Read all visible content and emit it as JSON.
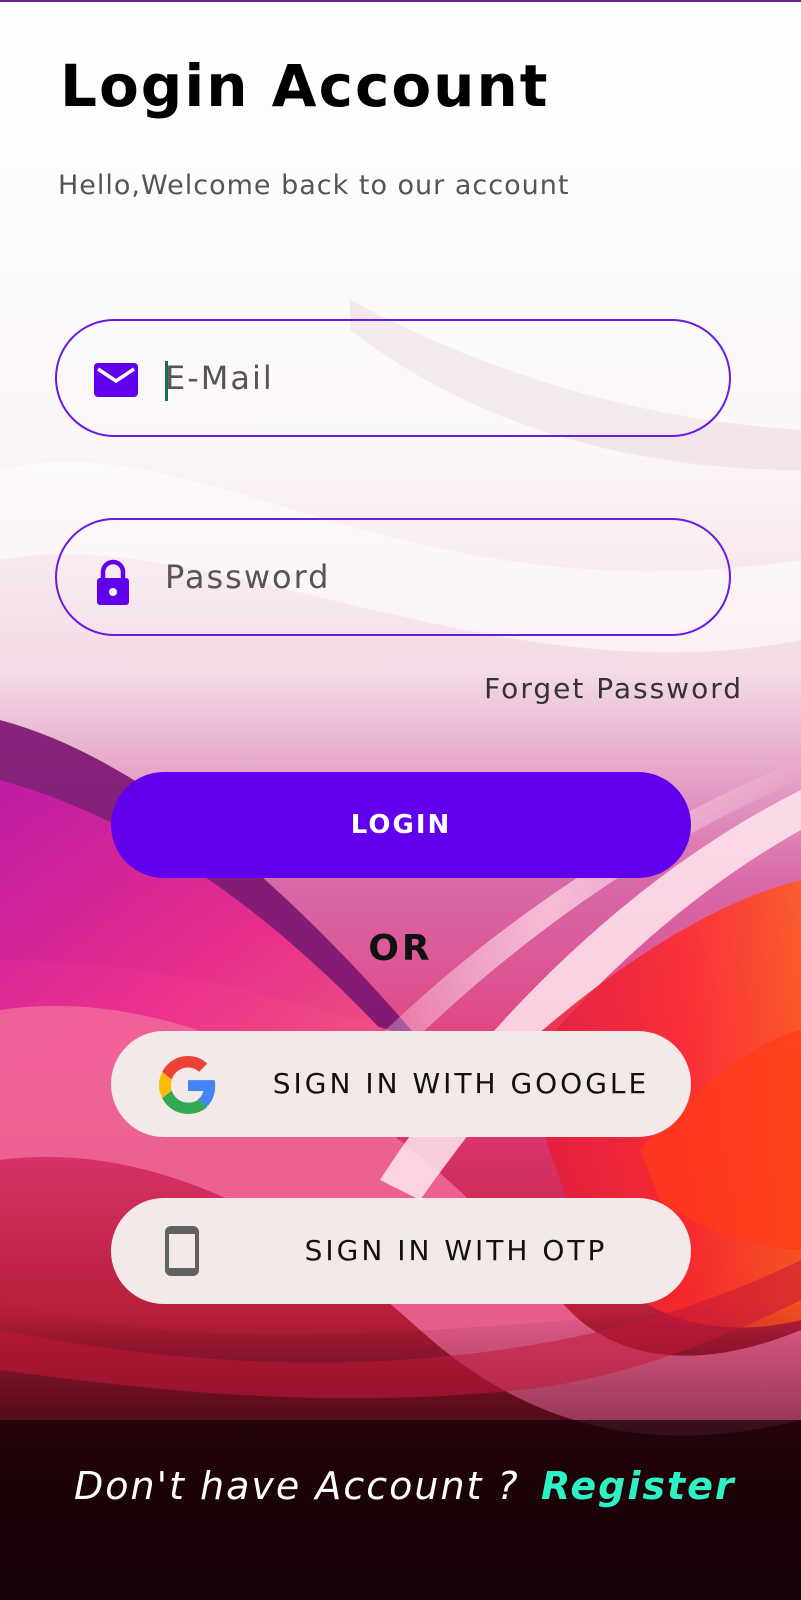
{
  "header": {
    "title": "Login Account",
    "subtitle": "Hello,Welcome back to our account"
  },
  "form": {
    "email": {
      "value": "",
      "placeholder": "E-Mail",
      "icon": "email-icon"
    },
    "password": {
      "value": "",
      "placeholder": "Password",
      "icon": "lock-icon"
    },
    "forget_label": "Forget Password",
    "login_label": "LOGIN"
  },
  "divider": {
    "or_label": "OR"
  },
  "social": {
    "google_label": "SIGN IN WITH GOOGLE",
    "google_icon": "google-logo-icon",
    "otp_label": "SIGN IN WITH OTP",
    "otp_icon": "smartphone-icon"
  },
  "footer": {
    "question": "Don't have Account ?",
    "register_label": "Register"
  },
  "colors": {
    "accent": "#6200ee",
    "field_border": "#6a1be0",
    "register": "#2ef2c6",
    "social_button_bg": "#f3e9e8"
  }
}
